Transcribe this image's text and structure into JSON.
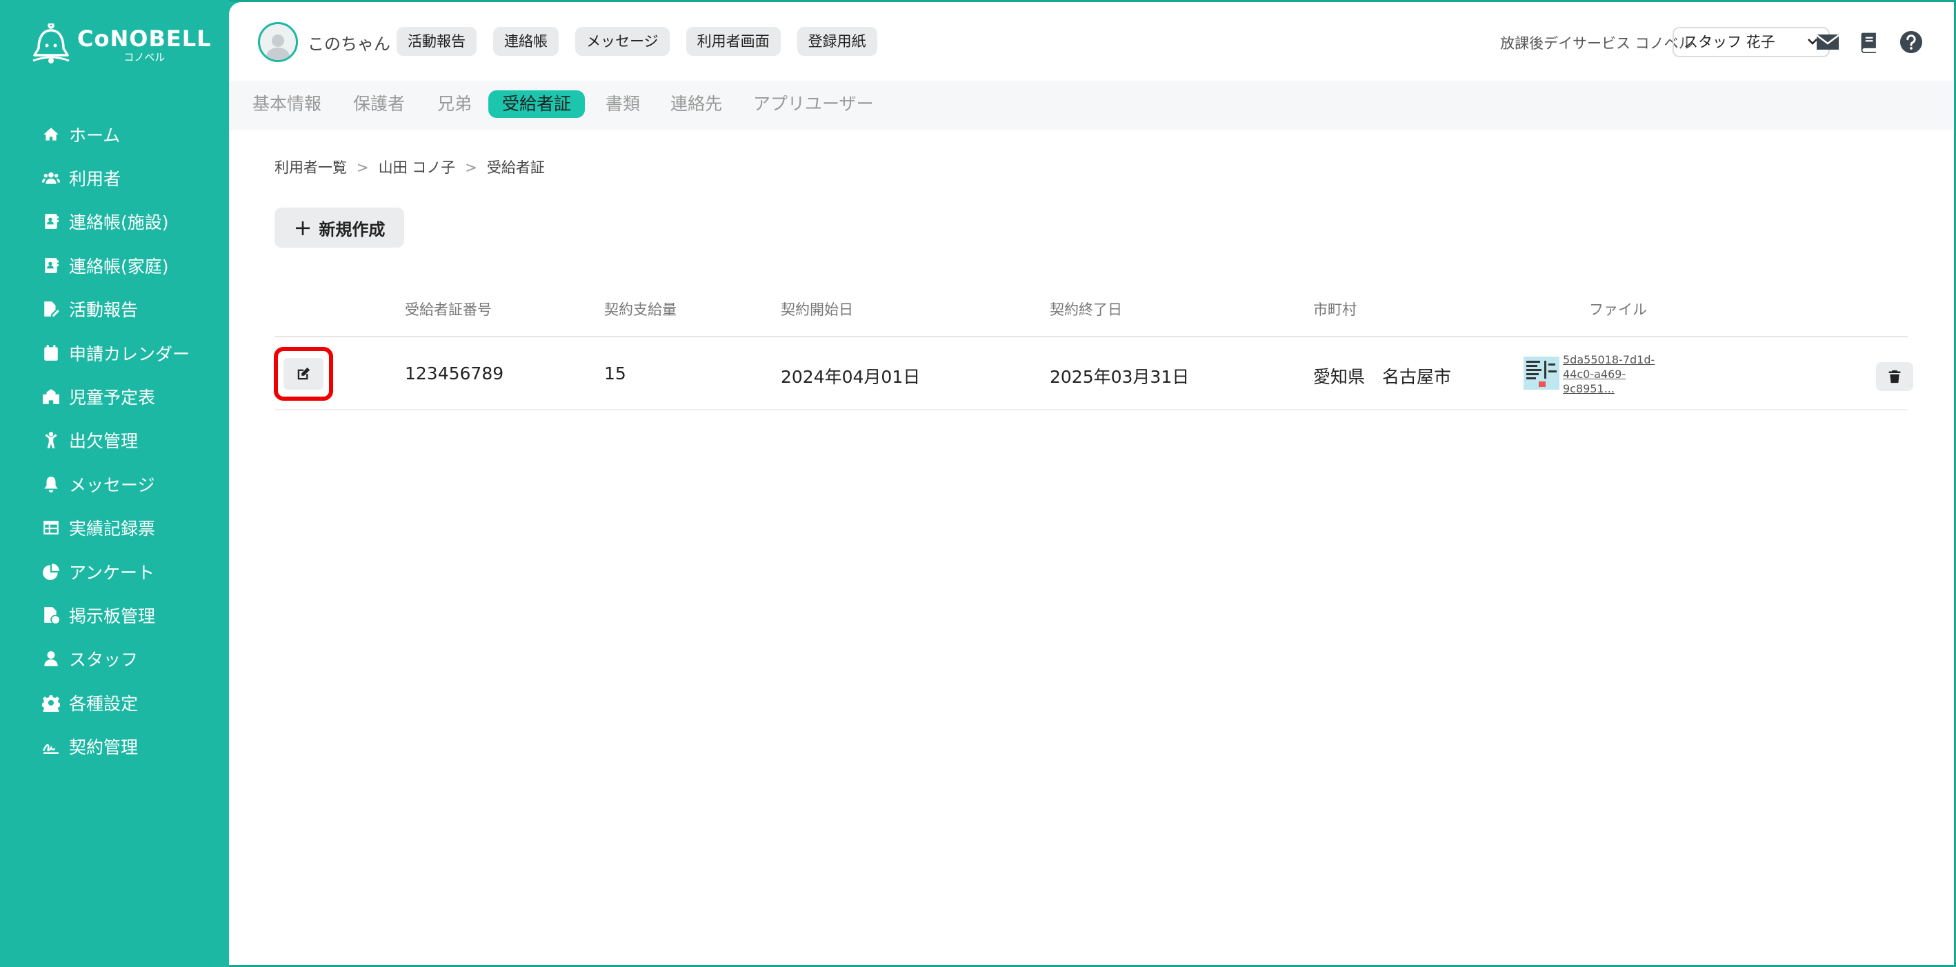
{
  "brand": {
    "logo_main": "CoNOBELL",
    "logo_sub": "コノベル"
  },
  "sidebar": {
    "items": [
      {
        "label": "ホーム",
        "icon": "home-icon"
      },
      {
        "label": "利用者",
        "icon": "users-icon"
      },
      {
        "label": "連絡帳(施設)",
        "icon": "contact-book-icon"
      },
      {
        "label": "連絡帳(家庭)",
        "icon": "contact-book-icon"
      },
      {
        "label": "活動報告",
        "icon": "file-pen-icon"
      },
      {
        "label": "申請カレンダー",
        "icon": "calendar-icon"
      },
      {
        "label": "児童予定表",
        "icon": "school-icon"
      },
      {
        "label": "出欠管理",
        "icon": "child-icon"
      },
      {
        "label": "メッセージ",
        "icon": "bell-icon"
      },
      {
        "label": "実績記録票",
        "icon": "table-icon"
      },
      {
        "label": "アンケート",
        "icon": "pie-chart-icon"
      },
      {
        "label": "掲示板管理",
        "icon": "file-image-icon"
      },
      {
        "label": "スタッフ",
        "icon": "staff-icon"
      },
      {
        "label": "各種設定",
        "icon": "gear-icon"
      },
      {
        "label": "契約管理",
        "icon": "signature-icon"
      }
    ]
  },
  "header": {
    "user_name": "このちゃん",
    "buttons": [
      "活動報告",
      "連絡帳",
      "メッセージ",
      "利用者画面",
      "登録用紙"
    ],
    "facility": "放課後デイサービス コノベル",
    "staff_selected": "スタッフ 花子"
  },
  "tabs": [
    {
      "label": "基本情報",
      "active": false
    },
    {
      "label": "保護者",
      "active": false
    },
    {
      "label": "兄弟",
      "active": false
    },
    {
      "label": "受給者証",
      "active": true
    },
    {
      "label": "書類",
      "active": false
    },
    {
      "label": "連絡先",
      "active": false
    },
    {
      "label": "アプリユーザー",
      "active": false
    }
  ],
  "breadcrumb": [
    "利用者一覧",
    "山田 コノ子",
    "受給者証"
  ],
  "new_button_label": "新規作成",
  "table": {
    "columns": [
      "受給者証番号",
      "契約支給量",
      "契約開始日",
      "契約終了日",
      "市町村",
      "ファイル"
    ],
    "rows": [
      {
        "number": "123456789",
        "amount": "15",
        "start": "2024年04月01日",
        "end": "2025年03月31日",
        "city": "愛知県　名古屋市",
        "file_line1": "5da55018-7d1d-",
        "file_line2": "44c0-a469-",
        "file_line3": "9c8951..."
      }
    ]
  },
  "colors": {
    "accent": "#1cb8a4",
    "highlight": "#ee0000"
  }
}
